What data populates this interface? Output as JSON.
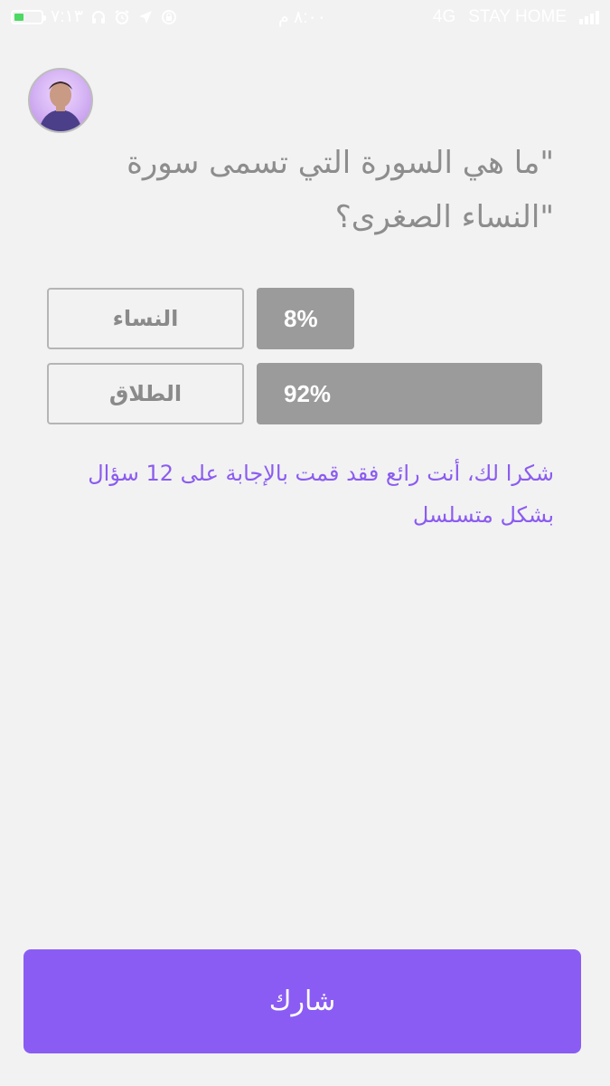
{
  "status_bar": {
    "time_left": "٧:١٣",
    "clock": "٨:٠٠ م",
    "network": "4G",
    "carrier": "STAY HOME",
    "battery_level": 0.35
  },
  "question": {
    "text": "\"ما هي السورة التي تسمى سورة \"النساء الصغرى؟"
  },
  "answers": [
    {
      "label": "النساء",
      "percent_text": "8%",
      "percent": 8
    },
    {
      "label": "الطلاق",
      "percent_text": "92%",
      "percent": 92
    }
  ],
  "thanks_message": "شكرا لك، أنت رائع فقد قمت بالإجابة على 12 سؤال بشكل متسلسل",
  "share_button": {
    "label": "شارك"
  },
  "colors": {
    "accent": "#8b5cf3",
    "bar": "#9b9b9b",
    "background": "#f2f2f2"
  }
}
